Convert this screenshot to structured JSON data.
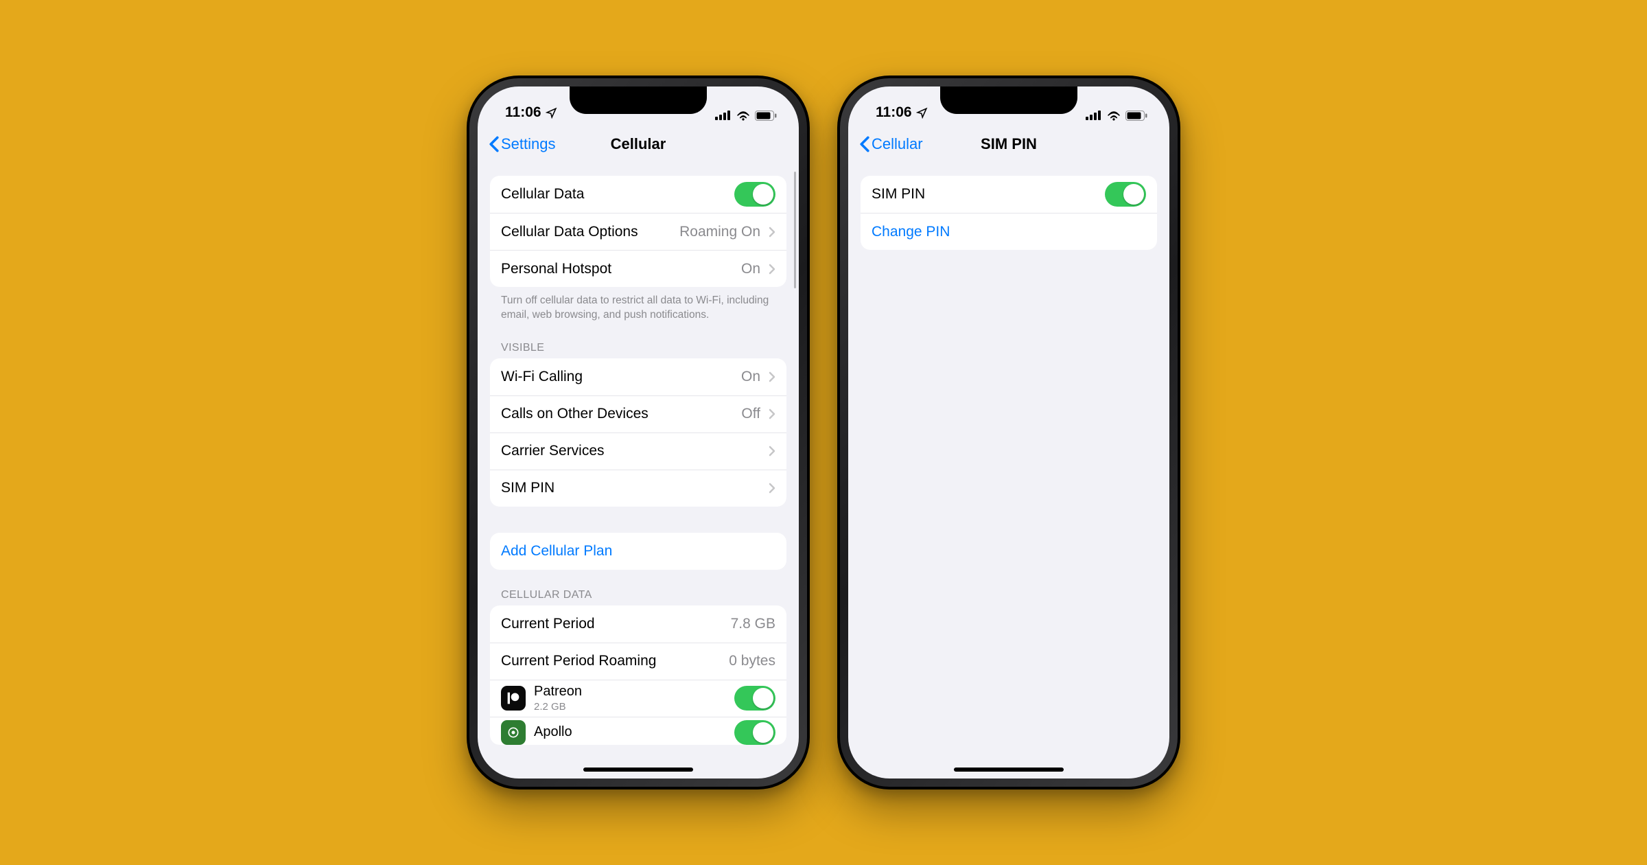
{
  "statusbar": {
    "time": "11:06"
  },
  "phoneA": {
    "nav": {
      "back": "Settings",
      "title": "Cellular"
    },
    "group1": {
      "cellular_data": "Cellular Data",
      "cellular_data_options": "Cellular Data Options",
      "cellular_data_options_detail": "Roaming On",
      "personal_hotspot": "Personal Hotspot",
      "personal_hotspot_detail": "On"
    },
    "group1_footer": "Turn off cellular data to restrict all data to Wi-Fi, including email, web browsing, and push notifications.",
    "section_visible": "VISIBLE",
    "group2": {
      "wifi_calling": "Wi-Fi Calling",
      "wifi_calling_detail": "On",
      "calls_other": "Calls on Other Devices",
      "calls_other_detail": "Off",
      "carrier_services": "Carrier Services",
      "sim_pin": "SIM PIN"
    },
    "group3": {
      "add_plan": "Add Cellular Plan"
    },
    "section_data": "CELLULAR DATA",
    "group4": {
      "current_period": "Current Period",
      "current_period_value": "7.8 GB",
      "current_period_roaming": "Current Period Roaming",
      "current_period_roaming_value": "0 bytes",
      "app_patreon": "Patreon",
      "app_patreon_usage": "2.2 GB",
      "app_apollo": "Apollo"
    }
  },
  "phoneB": {
    "nav": {
      "back": "Cellular",
      "title": "SIM PIN"
    },
    "group1": {
      "sim_pin": "SIM PIN",
      "change_pin": "Change PIN"
    }
  }
}
